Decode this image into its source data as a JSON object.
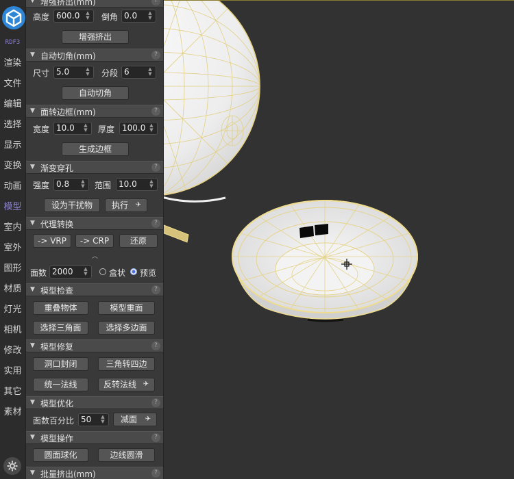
{
  "sidebar": {
    "brand": "RDF3",
    "items": [
      "渲染",
      "文件",
      "编辑",
      "选择",
      "显示",
      "变换",
      "动画",
      "模型",
      "室内",
      "室外",
      "图形",
      "材质",
      "灯光",
      "相机",
      "修改",
      "实用",
      "其它",
      "素材"
    ],
    "active": "模型"
  },
  "panel": {
    "s0": {
      "title": "增强挤出(mm)",
      "height_label": "高度",
      "height_value": "600.0",
      "chamfer_label": "倒角",
      "chamfer_value": "0.0",
      "button": "增强挤出"
    },
    "s1": {
      "title": "自动切角(mm)",
      "size_label": "尺寸",
      "size_value": "5.0",
      "seg_label": "分段",
      "seg_value": "6",
      "button": "自动切角"
    },
    "s2": {
      "title": "面转边框(mm)",
      "width_label": "宽度",
      "width_value": "10.0",
      "thick_label": "厚度",
      "thick_value": "100.0",
      "button": "生成边框"
    },
    "s3": {
      "title": "渐变穿孔",
      "strength_label": "强度",
      "strength_value": "0.8",
      "range_label": "范围",
      "range_value": "10.0",
      "btn_set": "设为干扰物",
      "btn_exec": "执行"
    },
    "s4": {
      "title": "代理转换",
      "btn_vrp": "-> VRP",
      "btn_crp": "-> CRP",
      "btn_restore": "还原",
      "faces_label": "面数",
      "faces_value": "2000",
      "opt_box": "盒状",
      "opt_preview": "预览"
    },
    "s5": {
      "title": "模型检查",
      "b1": "重叠物体",
      "b2": "模型重面",
      "b3": "选择三角面",
      "b4": "选择多边面"
    },
    "s6": {
      "title": "模型修复",
      "b1": "洞口封闭",
      "b2": "三角转四边",
      "b3": "统一法线",
      "b4": "反转法线"
    },
    "s7": {
      "title": "模型优化",
      "pct_label": "面数百分比",
      "pct_value": "50",
      "button": "减面"
    },
    "s8": {
      "title": "模型操作",
      "b1": "圆面球化",
      "b2": "边线圆滑"
    },
    "s9": {
      "title": "批量挤出(mm)"
    }
  },
  "icons": {
    "section_arrow": "▼",
    "help": "?",
    "dropdown": "arrow-down-icon",
    "settings": "gear-icon"
  },
  "colors": {
    "wire": "#efdc8e",
    "accent": "#8a7fd0",
    "logo": "#2f86d6"
  }
}
